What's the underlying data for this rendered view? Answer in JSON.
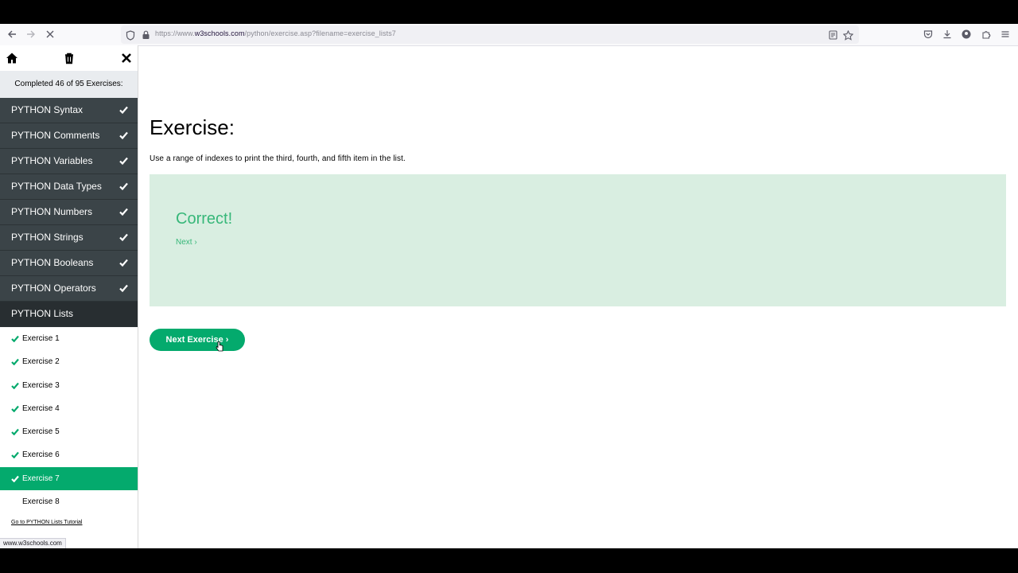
{
  "browser": {
    "url_prefix": "https://www.",
    "url_domain": "w3schools.com",
    "url_path": "/python/exercise.asp?filename=exercise_lists7",
    "status_text": "www.w3schools.com",
    "icons": [
      "back-arrow-icon",
      "forward-arrow-icon",
      "stop-icon",
      "shield-icon",
      "lock-icon",
      "reader-view-icon",
      "bookmark-star-icon",
      "pocket-icon",
      "download-icon",
      "account-icon",
      "extensions-icon",
      "menu-icon"
    ]
  },
  "sidebar": {
    "completed_text": "Completed 46 of 95 Exercises:",
    "topics": [
      {
        "label": "PYTHON Syntax",
        "done": true
      },
      {
        "label": "PYTHON Comments",
        "done": true
      },
      {
        "label": "PYTHON Variables",
        "done": true
      },
      {
        "label": "PYTHON Data Types",
        "done": true
      },
      {
        "label": "PYTHON Numbers",
        "done": true
      },
      {
        "label": "PYTHON Strings",
        "done": true
      },
      {
        "label": "PYTHON Booleans",
        "done": true
      },
      {
        "label": "PYTHON Operators",
        "done": true
      },
      {
        "label": "PYTHON Lists",
        "done": false
      }
    ],
    "exercises": [
      {
        "label": "Exercise 1",
        "done": true
      },
      {
        "label": "Exercise 2",
        "done": true
      },
      {
        "label": "Exercise 3",
        "done": true
      },
      {
        "label": "Exercise 4",
        "done": true
      },
      {
        "label": "Exercise 5",
        "done": true
      },
      {
        "label": "Exercise 6",
        "done": true
      },
      {
        "label": "Exercise 7",
        "done": true
      },
      {
        "label": "Exercise 8",
        "done": false
      }
    ],
    "tutorial_link": "Go to PYTHON Lists Tutorial"
  },
  "main": {
    "title": "Exercise:",
    "description": "Use a range of indexes to print the third, fourth, and fifth item in the list.",
    "result_title": "Correct!",
    "next_link": "Next ›",
    "next_button": "Next Exercise ›"
  },
  "colors": {
    "accent": "#04aa6d",
    "sidebar_dark": "#3b4448",
    "correct_bg": "#d9eee1",
    "correct_text": "#37b779"
  }
}
